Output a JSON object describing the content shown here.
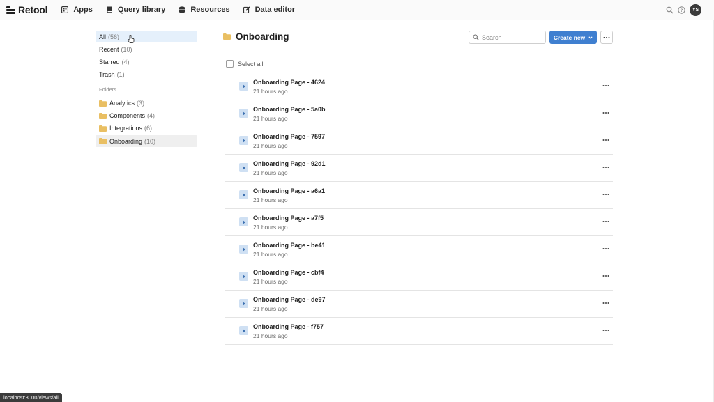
{
  "brand": {
    "name": "Retool"
  },
  "nav": [
    {
      "label": "Apps",
      "icon": "apps-icon"
    },
    {
      "label": "Query library",
      "icon": "book-icon"
    },
    {
      "label": "Resources",
      "icon": "database-icon"
    },
    {
      "label": "Data editor",
      "icon": "edit-icon"
    }
  ],
  "user": {
    "initials": "YS"
  },
  "sidebar": {
    "views": [
      {
        "label": "All",
        "count": "(56)"
      },
      {
        "label": "Recent",
        "count": "(10)"
      },
      {
        "label": "Starred",
        "count": "(4)"
      },
      {
        "label": "Trash",
        "count": "(1)"
      }
    ],
    "folders_heading": "Folders",
    "folders": [
      {
        "label": "Analytics",
        "count": "(3)"
      },
      {
        "label": "Components",
        "count": "(4)"
      },
      {
        "label": "Integrations",
        "count": "(6)"
      },
      {
        "label": "Onboarding",
        "count": "(10)"
      }
    ]
  },
  "main": {
    "title": "Onboarding",
    "search_placeholder": "Search",
    "create_label": "Create new",
    "select_all_label": "Select all",
    "apps": [
      {
        "name": "Onboarding Page - 4624",
        "time": "21 hours ago"
      },
      {
        "name": "Onboarding Page - 5a0b",
        "time": "21 hours ago"
      },
      {
        "name": "Onboarding Page - 7597",
        "time": "21 hours ago"
      },
      {
        "name": "Onboarding Page - 92d1",
        "time": "21 hours ago"
      },
      {
        "name": "Onboarding Page - a6a1",
        "time": "21 hours ago"
      },
      {
        "name": "Onboarding Page - a7f5",
        "time": "21 hours ago"
      },
      {
        "name": "Onboarding Page - be41",
        "time": "21 hours ago"
      },
      {
        "name": "Onboarding Page - cbf4",
        "time": "21 hours ago"
      },
      {
        "name": "Onboarding Page - de97",
        "time": "21 hours ago"
      },
      {
        "name": "Onboarding Page - f757",
        "time": "21 hours ago"
      }
    ]
  },
  "statusbar": {
    "url": "localhost:3000/views/all"
  },
  "colors": {
    "accent": "#3f7fd0",
    "folder": "#e9bf63",
    "selected_bg": "#e5f0fb"
  }
}
